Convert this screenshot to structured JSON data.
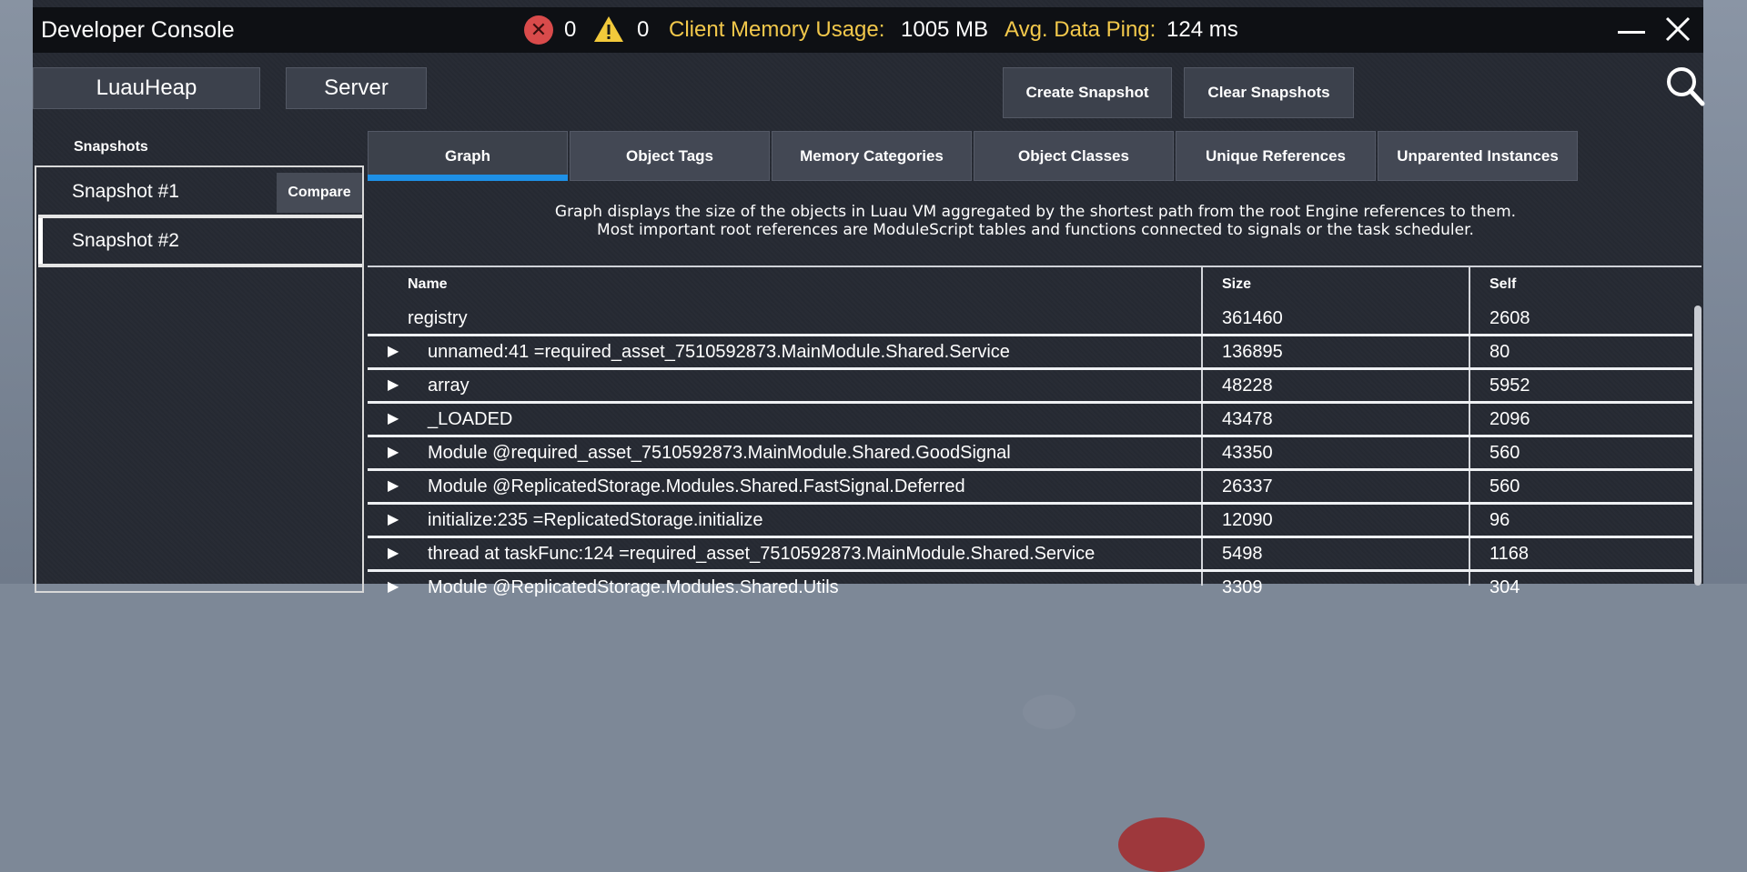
{
  "window": {
    "title": "Developer Console",
    "error_count": "0",
    "warning_count": "0",
    "memory_label": "Client Memory Usage:",
    "memory_value": "1005 MB",
    "ping_label": "Avg. Data Ping:",
    "ping_value": "124 ms"
  },
  "toolbar": {
    "luauheap": "LuauHeap",
    "server": "Server",
    "create_snapshot": "Create Snapshot",
    "clear_snapshots": "Clear Snapshots"
  },
  "snapshots": {
    "header": "Snapshots",
    "compare_label": "Compare",
    "items": [
      {
        "label": "Snapshot #1"
      },
      {
        "label": "Snapshot #2"
      }
    ]
  },
  "tabs": [
    {
      "label": "Graph",
      "active": true
    },
    {
      "label": "Object Tags"
    },
    {
      "label": "Memory Categories"
    },
    {
      "label": "Object Classes"
    },
    {
      "label": "Unique References"
    },
    {
      "label": "Unparented Instances"
    }
  ],
  "description": {
    "line1": "Graph displays the size of the objects in Luau VM aggregated by the shortest path from the root Engine references to them.",
    "line2": "Most important root references are ModuleScript tables and functions connected to signals or the task scheduler."
  },
  "table": {
    "headers": {
      "name": "Name",
      "size": "Size",
      "self": "Self"
    },
    "rows": [
      {
        "name": "registry",
        "size": "361460",
        "self": "2608"
      },
      {
        "name": "unnamed:41 =required_asset_7510592873.MainModule.Shared.Service",
        "size": "136895",
        "self": "80"
      },
      {
        "name": "array",
        "size": "48228",
        "self": "5952"
      },
      {
        "name": "_LOADED",
        "size": "43478",
        "self": "2096"
      },
      {
        "name": "Module @required_asset_7510592873.MainModule.Shared.GoodSignal",
        "size": "43350",
        "self": "560"
      },
      {
        "name": "Module @ReplicatedStorage.Modules.Shared.FastSignal.Deferred",
        "size": "26337",
        "self": "560"
      },
      {
        "name": "initialize:235 =ReplicatedStorage.initialize",
        "size": "12090",
        "self": "96"
      },
      {
        "name": "thread at taskFunc:124 =required_asset_7510592873.MainModule.Shared.Service",
        "size": "5498",
        "self": "1168"
      },
      {
        "name": "Module @ReplicatedStorage.Modules.Shared.Utils",
        "size": "3309",
        "self": "304"
      }
    ]
  },
  "colors": {
    "accent_tab_underline": "#1e90e6",
    "title_label_yellow": "#f2c84b",
    "error_red": "#d94b4b",
    "warning_yellow": "#f2c93b"
  },
  "icons": {
    "error": "error-x-circle-icon",
    "warning": "warning-triangle-icon",
    "minimize": "minimize-icon",
    "close": "close-icon",
    "search": "search-icon",
    "expand": "expand-arrow-icon"
  }
}
